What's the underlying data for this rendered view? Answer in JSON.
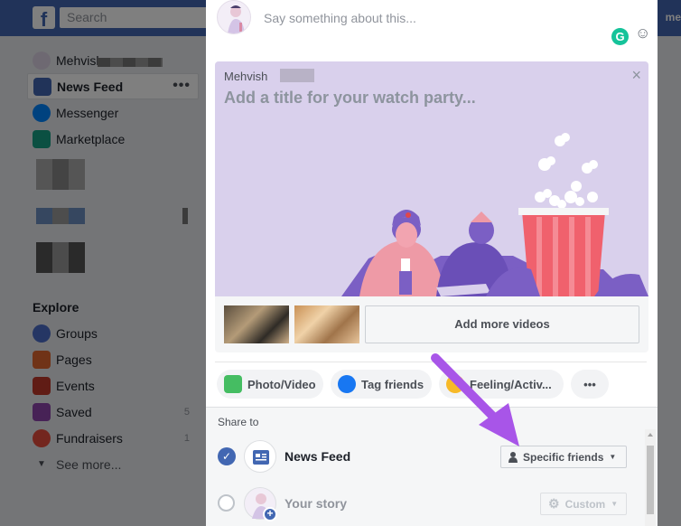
{
  "topbar": {
    "logo": "f",
    "search_placeholder": "Search",
    "right_text": "me"
  },
  "sidebar": {
    "profile_name": "Mehvish",
    "items": [
      {
        "label": "News Feed",
        "icon": "news-feed-icon",
        "color": "#4267b2"
      },
      {
        "label": "Messenger",
        "icon": "messenger-icon",
        "color": "#0084ff"
      },
      {
        "label": "Marketplace",
        "icon": "marketplace-icon",
        "color": "#16a085"
      }
    ],
    "dots": "•••",
    "explore_heading": "Explore",
    "explore": [
      {
        "label": "Groups",
        "icon": "groups-icon",
        "color": "#4a6cc9",
        "count": ""
      },
      {
        "label": "Pages",
        "icon": "pages-icon",
        "color": "#e0672f",
        "count": ""
      },
      {
        "label": "Events",
        "icon": "events-icon",
        "color": "#c0392b",
        "count": ""
      },
      {
        "label": "Saved",
        "icon": "saved-icon",
        "color": "#8e44ad",
        "count": "5"
      },
      {
        "label": "Fundraisers",
        "icon": "fundraisers-icon",
        "color": "#e74c3c",
        "count": "1"
      }
    ],
    "see_more": "See more..."
  },
  "composer": {
    "placeholder": "Say something about this...",
    "grammarly": "G",
    "smiley": "☺"
  },
  "watch_party": {
    "host_name": "Mehvish",
    "title_placeholder": "Add a title for your watch party...",
    "close": "×",
    "add_videos": "Add more videos",
    "colors": {
      "banner": "#d9d0ec",
      "popcorn": "#f0616d",
      "figures": "#7b5fc4"
    }
  },
  "actions": [
    {
      "label": "Photo/Video",
      "icon": "photo-video-icon",
      "color": "#45bd62"
    },
    {
      "label": "Tag friends",
      "icon": "tag-friends-icon",
      "color": "#1877f2"
    },
    {
      "label": "Feeling/Activ...",
      "icon": "feeling-icon",
      "color": "#f7b928"
    },
    {
      "label": "•••",
      "icon": "more-icon",
      "color": "#4b4f56"
    }
  ],
  "share": {
    "heading": "Share to",
    "rows": [
      {
        "label": "News Feed",
        "checked": true,
        "audience": "Specific friends",
        "audience_icon": "person-icon"
      },
      {
        "label": "Your story",
        "checked": false,
        "audience": "Custom",
        "audience_icon": "gear-icon"
      }
    ]
  },
  "annotation": {
    "color": "#a855e8"
  }
}
